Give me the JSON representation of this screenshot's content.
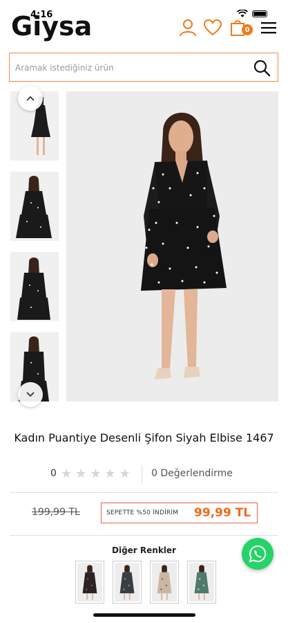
{
  "status_bar": {
    "time": "4:16"
  },
  "header": {
    "logo": "Giysa",
    "cart_count": "0",
    "accent_color": "#f07a1a"
  },
  "search": {
    "placeholder": "Aramak istediğiniz ürün"
  },
  "gallery": {
    "thumbnail_count": 4,
    "thumbnail_poses": [
      "standing-full",
      "standing-half",
      "hands-clasped",
      "arms-down"
    ]
  },
  "product": {
    "title": "Kadın Puantiye Desenli Şifon Siyah Elbise 1467",
    "rating": "0",
    "star_count": 5,
    "review_label": "0 Değerlendirme",
    "old_price": "199,99 TL",
    "promo_label": "SEPETTE %50 İNDİRİM",
    "new_price": "99,99 TL"
  },
  "other_colors": {
    "label": "Diğer Renkler",
    "swatches": [
      {
        "name": "black-floral",
        "dress_color": "#2a2424",
        "accent": "#b04a5c"
      },
      {
        "name": "dark-print",
        "dress_color": "#3a3d42",
        "accent": "#8aa0b0"
      },
      {
        "name": "beige-print",
        "dress_color": "#c9b7a2",
        "accent": "#6b5b4d"
      },
      {
        "name": "green-print",
        "dress_color": "#4f7a6a",
        "accent": "#cfe2d8"
      }
    ]
  },
  "colors": {
    "price_accent": "#f26a1b",
    "promo_border": "#e7644a",
    "whatsapp": "#25d366"
  }
}
